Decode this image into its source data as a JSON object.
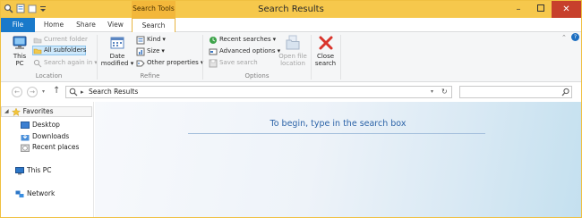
{
  "window": {
    "title": "Search Results"
  },
  "context_tab_header": "Search Tools",
  "ribbon_tabs": [
    "File",
    "Home",
    "Share",
    "View",
    "Search"
  ],
  "location_group": {
    "label": "Location",
    "this_pc": "This PC",
    "current_folder": "Current folder",
    "all_subfolders": "All subfolders",
    "search_again_in": "Search again in"
  },
  "refine_group": {
    "label": "Refine",
    "date_modified": "Date modified",
    "kind": "Kind",
    "size": "Size",
    "other_properties": "Other properties"
  },
  "options_group": {
    "label": "Options",
    "recent_searches": "Recent searches",
    "advanced_options": "Advanced options",
    "save_search": "Save search",
    "open_file_location": "Open file location"
  },
  "close_group": {
    "close_search": "Close search"
  },
  "address": {
    "path": "Search Results"
  },
  "nav_pane": {
    "favorites": "Favorites",
    "desktop": "Desktop",
    "downloads": "Downloads",
    "recent_places": "Recent places",
    "this_pc": "This PC",
    "network": "Network"
  },
  "content": {
    "hint": "To begin, type in the search box"
  },
  "colors": {
    "title_bar": "#f6c84c",
    "file_tab": "#1979ca",
    "close_button": "#c7402c",
    "hint_text": "#2d64a8"
  }
}
